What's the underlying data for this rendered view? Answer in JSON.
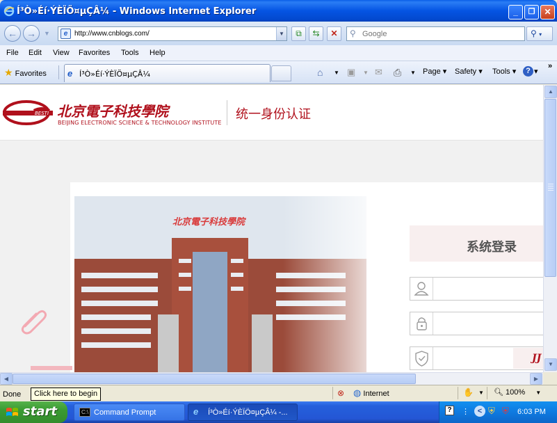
{
  "window": {
    "title": "Í³Ò»Éí·ÝÈÏÖ¤µÇÂ¼ - Windows Internet Explorer",
    "minimize": "_",
    "maximize": "❐",
    "close": "✕"
  },
  "address": {
    "url": "http://www.cnblogs.com/",
    "search_placeholder": "Google"
  },
  "menu": {
    "items": [
      "File",
      "Edit",
      "View",
      "Favorites",
      "Tools",
      "Help"
    ]
  },
  "favorites_bar": {
    "favorites_label": "Favorites",
    "tab_label": "Í³Ò»Éí·ÝÈÏÖ¤µÇÂ¼",
    "page_menu": "Page ▾",
    "safety_menu": "Safety ▾",
    "tools_menu": "Tools ▾",
    "help_menu": "▾",
    "overflow": "»"
  },
  "site": {
    "logo_cn": "北京電子科技學院",
    "logo_en": "BEIJING ELECTRONIC SCIENCE & TECHNOLOGY INSTITUTE",
    "header_title": "统一身份认证",
    "building_sign": "北京電子科技學院",
    "login_title": "系统登录",
    "captcha_code": "JJ"
  },
  "statusbar": {
    "status_text": "Done",
    "tooltip": "Click here to begin",
    "zone": "Internet",
    "zoom": "100%"
  },
  "taskbar": {
    "start_label": "start",
    "items": [
      {
        "label": "Command Prompt"
      },
      {
        "label": "Í³Ò»Éí·ÝÈÏÖ¤µÇÂ¼ -..."
      }
    ],
    "clock": "6:03 PM"
  },
  "colors": {
    "brand_red": "#b0101c",
    "xp_blue": "#0554e3",
    "start_green": "#3a9b33"
  }
}
